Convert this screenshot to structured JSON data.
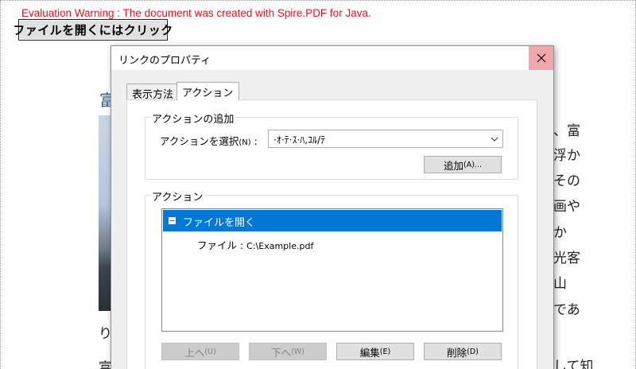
{
  "document": {
    "eval_warning": "Evaluation Warning : The document was created with Spire.PDF for Java.",
    "link_button_label": "ファイルを開くにはクリック",
    "bg_heading_fragment": "富",
    "bg_left_chars": [
      "り",
      "富"
    ],
    "bg_right_text": [
      "、富",
      "浮か",
      "その",
      "画や",
      "か",
      "光客",
      "山",
      "であ",
      "して知"
    ]
  },
  "dialog": {
    "title": "リンクのプロパティ",
    "close_glyph": "✕",
    "tabs": [
      {
        "label": "表示方法",
        "active": false
      },
      {
        "label": "アクション",
        "active": true
      }
    ],
    "add_group": {
      "label": "アクションの追加",
      "select_label": "アクションを選択",
      "select_mnemonic": "(N)",
      "select_colon": ":",
      "select_value": "·ｵ·ﾃ·ｽ·ﾊ,ﾕﾙ/ﾃ",
      "add_button": "追加",
      "add_button_mnemonic": "(A)..."
    },
    "actions_group": {
      "label": "アクション",
      "tree": {
        "selected_item": "ファイルを開く",
        "child_prefix": "ファイル : ",
        "child_path": "C:\\Example.pdf"
      },
      "buttons": [
        {
          "label": "上へ",
          "mnemonic": "(U)",
          "enabled": false
        },
        {
          "label": "下へ",
          "mnemonic": "(W)",
          "enabled": false
        },
        {
          "label": "編集",
          "mnemonic": "(E)",
          "enabled": true
        },
        {
          "label": "削除",
          "mnemonic": "(D)",
          "enabled": true
        }
      ]
    }
  },
  "colors": {
    "warning": "#e8141d",
    "selection": "#0078d7",
    "close_hover": "#f1a7ae",
    "heading": "#2f4e8a"
  }
}
